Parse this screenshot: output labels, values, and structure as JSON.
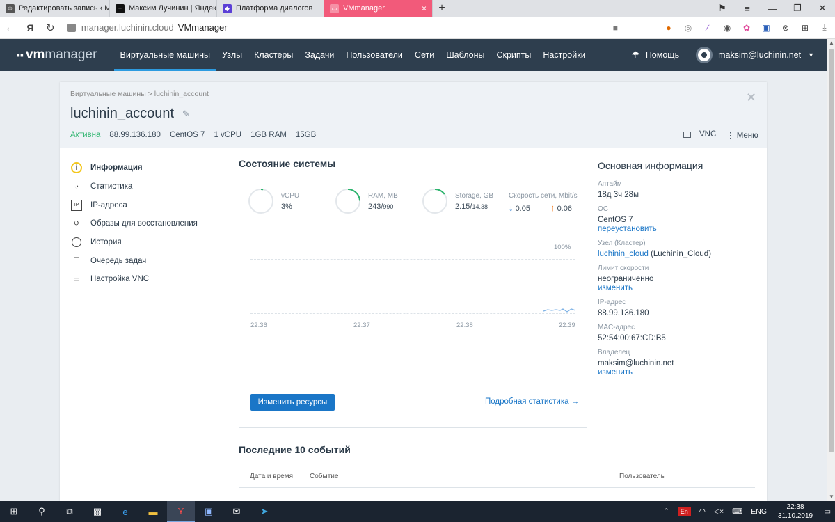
{
  "browser": {
    "tabs": [
      {
        "title": "Редактировать запись ‹ Ма",
        "icon": "person-icon",
        "color": "#555555"
      },
      {
        "title": "Максим Лучинин | Яндекс",
        "icon": "zen-icon",
        "color": "#111111"
      },
      {
        "title": "Платформа диалогов",
        "icon": "cube-icon",
        "color": "#5b3fd6"
      },
      {
        "title": "VMmanager",
        "icon": "vm-icon",
        "color": "#f25a7a",
        "active": true
      }
    ],
    "new_tab": "+",
    "close_glyph": "×",
    "url_host": "manager.luchinin.cloud",
    "url_title": "VMmanager",
    "yandex_glyph": "Я"
  },
  "app": {
    "logo_bold": "vm",
    "logo_light": "manager",
    "nav": [
      {
        "label": "Виртуальные машины",
        "active": true
      },
      {
        "label": "Узлы"
      },
      {
        "label": "Кластеры"
      },
      {
        "label": "Задачи"
      },
      {
        "label": "Пользователи"
      },
      {
        "label": "Сети"
      },
      {
        "label": "Шаблоны"
      },
      {
        "label": "Скрипты"
      },
      {
        "label": "Настройки"
      }
    ],
    "help_label": "Помощь",
    "user_email": "maksim@luchinin.net"
  },
  "vm": {
    "breadcrumb": "Виртуальные машины > luchinin_account",
    "name": "luchinin_account",
    "status": "Активна",
    "ip": "88.99.136.180",
    "os": "CentOS 7",
    "cpu": "1 vCPU",
    "ram": "1GB RAM",
    "disk": "15GB",
    "vnc_label": "VNC",
    "menu_label": "Меню"
  },
  "side_menu": [
    {
      "label": "Информация",
      "icon": "info-icon",
      "active": true
    },
    {
      "label": "Статистика",
      "icon": "pie-chart-icon"
    },
    {
      "label": "IP-адреса",
      "icon": "ip-icon"
    },
    {
      "label": "Образы для восстановления",
      "icon": "restore-icon"
    },
    {
      "label": "История",
      "icon": "history-icon"
    },
    {
      "label": "Очередь задач",
      "icon": "task-queue-icon"
    },
    {
      "label": "Настройка VNC",
      "icon": "vnc-icon"
    }
  ],
  "system": {
    "title": "Состояние системы",
    "metrics": [
      {
        "label": "vCPU",
        "value": "3%",
        "fraction": 0.03
      },
      {
        "label": "RAM, MB",
        "value": "243/",
        "total": "990",
        "fraction": 0.245
      },
      {
        "label": "Storage, GB",
        "value": "2.15/",
        "total": "14.38",
        "fraction": 0.15
      }
    ],
    "net_label": "Скорость сети, Mbit/s",
    "net_down": "0.05",
    "net_up": "0.06",
    "chart_pct": "100%",
    "ticks": [
      "22:36",
      "22:37",
      "22:38",
      "22:39"
    ],
    "resize_button": "Изменить ресурсы",
    "detail_link": "Подробная статистика →",
    "accent": "#2cb46d"
  },
  "events": {
    "title": "Последние 10 событий",
    "col_date": "Дата и время",
    "col_event": "Событие",
    "col_user": "Пользователь"
  },
  "info": {
    "title": "Основная информация",
    "uptime_label": "Аптайм",
    "uptime": "18д 3ч 28м",
    "os_label": "ОС",
    "os": "CentOS 7",
    "reinstall": "переустановить",
    "node_label": "Узел (Кластер)",
    "node_link": "luchinin_cloud",
    "node_cluster": " (Luchinin_Cloud)",
    "speed_label": "Лимит скорости",
    "speed": "неограниченно",
    "speed_change": "изменить",
    "ip_label": "IP-адрес",
    "ip": "88.99.136.180",
    "mac_label": "MAC-адрес",
    "mac": "52:54:00:67:CD:B5",
    "owner_label": "Владелец",
    "owner": "maksim@luchinin.net",
    "owner_change": "изменить"
  },
  "taskbar": {
    "lang_badge": "En",
    "lang": "ENG",
    "time": "22:38",
    "date": "31.10.2019"
  }
}
